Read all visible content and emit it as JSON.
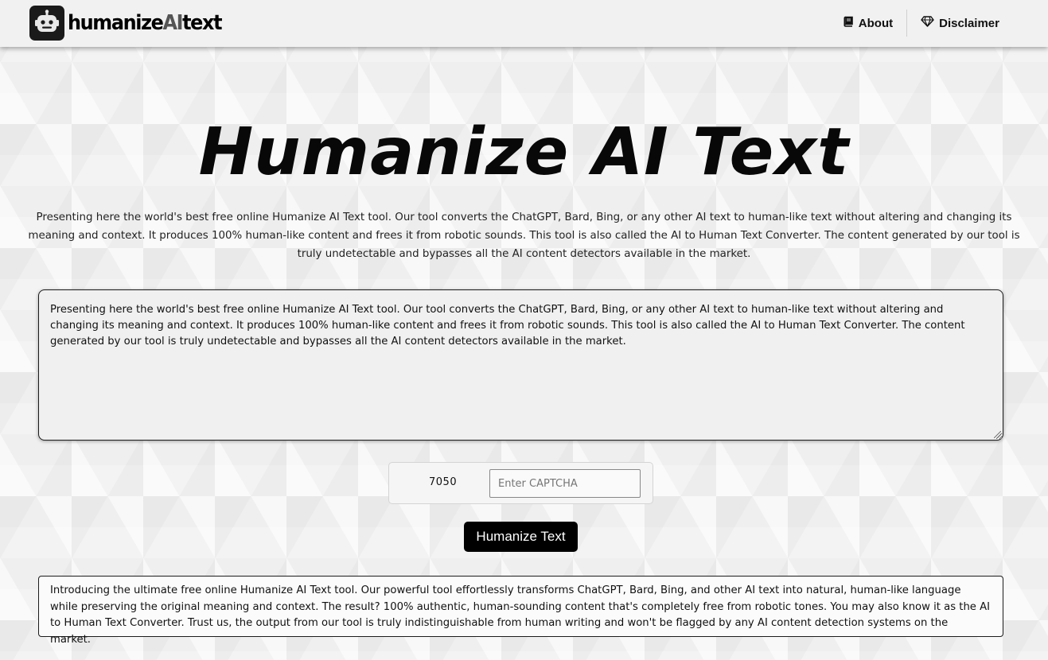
{
  "header": {
    "logo": {
      "part1": "humanize",
      "part2": "AI",
      "part3": "text"
    },
    "nav": [
      {
        "label": "About",
        "icon": "book-icon"
      },
      {
        "label": "Disclaimer",
        "icon": "diamond-icon"
      }
    ]
  },
  "main": {
    "title": "Humanize AI Text",
    "intro": "Presenting here the world's best free online Humanize AI Text tool. Our tool converts the ChatGPT, Bard, Bing, or any other AI text to human-like text without altering and changing its meaning and context. It produces 100% human-like content and frees it from robotic sounds. This tool is also called the AI to Human Text Converter. The content generated by our tool is truly undetectable and bypasses all the AI content detectors available in the market.",
    "input_text": "Presenting here the world's best free online Humanize AI Text tool. Our tool converts the ChatGPT, Bard, Bing, or any other AI text to human-like text without altering and changing its meaning and context. It produces 100% human-like content and frees it from robotic sounds. This tool is also called the AI to Human Text Converter. The content generated by our tool is truly undetectable and bypasses all the AI content detectors available in the market.",
    "captcha": {
      "code": "7050",
      "placeholder": "Enter CAPTCHA",
      "value": ""
    },
    "button_label": "Humanize Text",
    "output_text": "Introducing the ultimate free online Humanize AI Text tool. Our powerful tool effortlessly transforms ChatGPT, Bard, Bing, and other AI text into natural, human-like language while preserving the original meaning and context. The result? 100% authentic, human-sounding content that's completely free from robotic tones. You may also know it as the AI to Human Text Converter. Trust us, the output from our tool is truly indistinguishable from human writing and won't be flagged by any AI content detection systems on the market."
  }
}
